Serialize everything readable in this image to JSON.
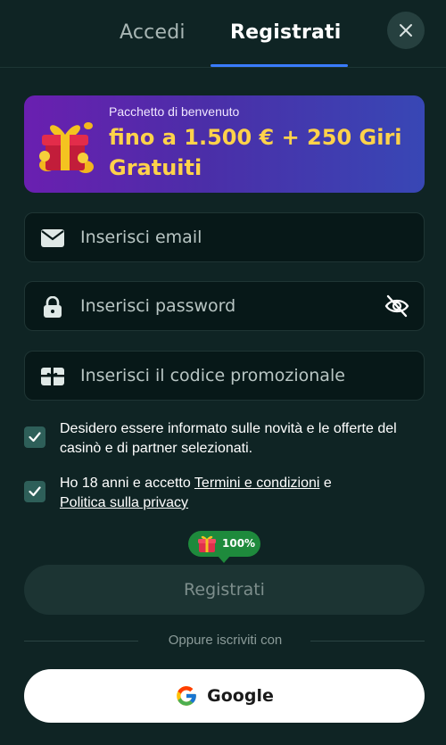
{
  "tabs": {
    "login_label": "Accedi",
    "register_label": "Registrati",
    "active": "register"
  },
  "banner": {
    "subtitle": "Pacchetto di benvenuto",
    "title": "fino a 1.500 € + 250 Giri Gratuiti",
    "icon": "gift-icon"
  },
  "form": {
    "email": {
      "placeholder": "Inserisci email",
      "value": "",
      "icon": "mail-icon"
    },
    "password": {
      "placeholder": "Inserisci password",
      "value": "",
      "icon": "lock-icon",
      "toggle_icon": "eye-off-icon"
    },
    "promo": {
      "placeholder": "Inserisci il codice promozionale",
      "value": "",
      "icon": "gift-card-icon"
    }
  },
  "consents": {
    "news": {
      "checked": true,
      "text": "Desidero essere informato sulle novità e le offerte del casinò e di partner selezionati."
    },
    "terms": {
      "checked": true,
      "prefix": "Ho 18 anni e accetto ",
      "terms_link": "Termini e condizioni",
      "middle": " e ",
      "privacy_link": "Politica sulla privacy"
    }
  },
  "progress": {
    "label": "100%",
    "value": 1.0
  },
  "submit": {
    "label": "Registrati"
  },
  "divider": {
    "text": "Oppure iscriviti con"
  },
  "google": {
    "label": "Google",
    "icon": "google-icon"
  },
  "colors": {
    "background": "#0f2424",
    "accent": "#3a7cff",
    "banner_title": "#ffd24a",
    "checkbox": "#2e5f59",
    "badge": "#1e8a3c"
  }
}
